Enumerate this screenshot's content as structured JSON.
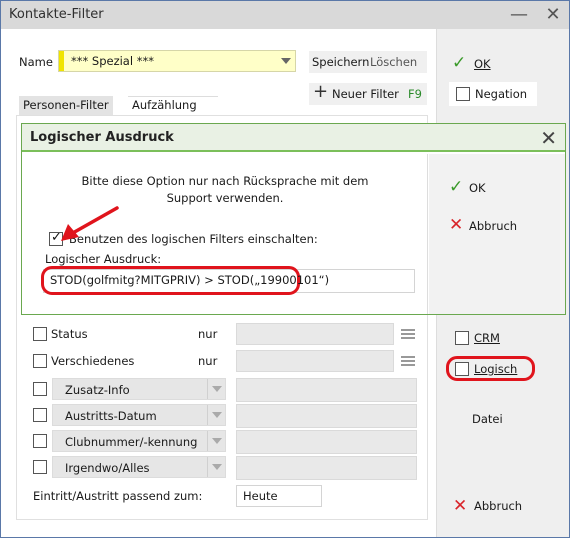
{
  "window": {
    "title": "Kontakte-Filter"
  },
  "filter_form": {
    "name_label": "Name",
    "name_value": "*** Spezial ***",
    "save_label": "Speichern",
    "delete_label": "Löschen",
    "new_filter_label": "Neuer Filter",
    "new_filter_shortcut": "F9",
    "tabs": [
      "Personen-Filter",
      "Aufzählung"
    ],
    "rows": [
      {
        "label": "Status",
        "mode": "nur"
      },
      {
        "label": "Verschiedenes",
        "mode": "nur"
      }
    ],
    "combo_rows": [
      "Zusatz-Info",
      "Austritts-Datum",
      "Clubnummer/-kennung",
      "Irgendwo/Alles"
    ],
    "entry_exit_label": "Eintritt/Austritt passend zum:",
    "entry_exit_value": "Heute"
  },
  "right_panel": {
    "ok_label": "OK",
    "negation_label": "Negation",
    "crm_label": "CRM",
    "logisch_label": "Logisch",
    "datei_label": "Datei",
    "abbruch_label": "Abbruch"
  },
  "dialog": {
    "title": "Logischer Ausdruck",
    "message_line1": "Bitte diese Option nur nach Rücksprache mit dem",
    "message_line2": "Support verwenden.",
    "checkbox_label": "Benutzen des logischen Filters einschalten:",
    "checkbox_checked": true,
    "expression_label": "Logischer Ausdruck:",
    "expression_value": "STOD(golfmitg?MITGPRIV) > STOD(„19900101“)",
    "ok_label": "OK",
    "cancel_label": "Abbruch"
  },
  "colors": {
    "accent_red": "#e0141c",
    "ok_green": "#3a9a2a",
    "dialog_border": "#6aa84f",
    "name_bg": "#ffffc8"
  }
}
